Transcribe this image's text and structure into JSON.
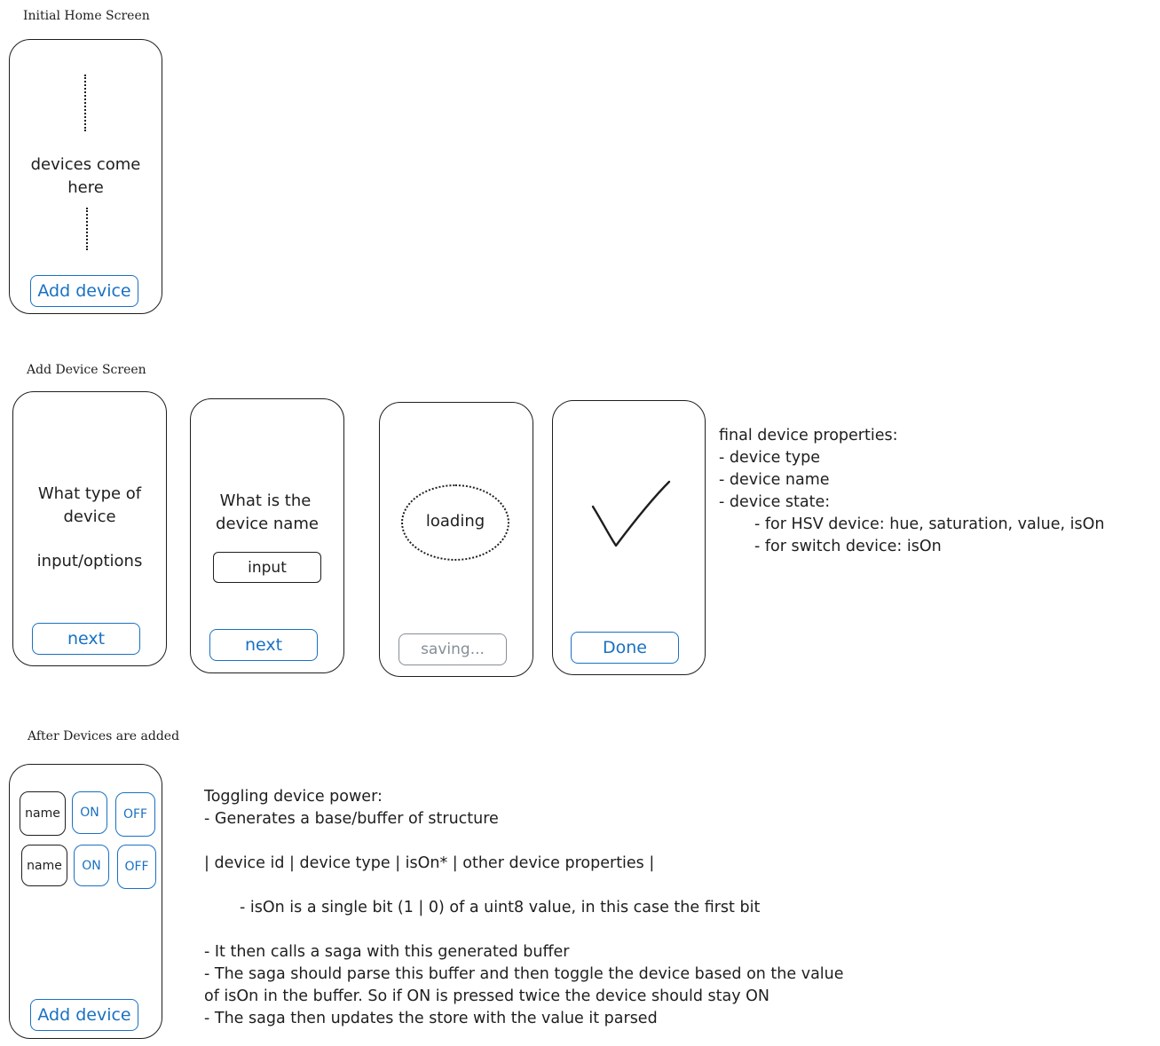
{
  "home": {
    "title": "Initial Home Screen",
    "placeholder_line1": "devices come",
    "placeholder_line2": "here",
    "add_button": "Add device"
  },
  "add_device": {
    "title": "Add Device Screen",
    "step1": {
      "line1": "What type of",
      "line2": "device",
      "line3": "input/options",
      "button": "next"
    },
    "step2": {
      "line1": "What is the",
      "line2": "device name",
      "input_label": "input",
      "button": "next"
    },
    "step3": {
      "loading": "loading",
      "button": "saving..."
    },
    "step4": {
      "button": "Done"
    },
    "properties_notes": [
      "final device properties:",
      "- device type",
      "- device name",
      "- device state:",
      "      - for HSV device: hue, saturation, value, isOn",
      "      - for switch device: isOn"
    ]
  },
  "after": {
    "title": "After Devices are added",
    "rows": [
      {
        "name": "name",
        "on": "ON",
        "off": "OFF"
      },
      {
        "name": "name",
        "on": "ON",
        "off": "OFF"
      }
    ],
    "add_button": "Add device",
    "notes": [
      "Toggling device power:",
      "- Generates a base/buffer of structure",
      "",
      "| device id | device type | isOn* | other device properties |",
      "",
      "     - isOn is a single bit (1 | 0) of a uint8 value, in this case the first bit",
      "",
      "- It then calls a saga with this generated buffer",
      "- The saga should parse this buffer and then toggle the device based on the value",
      "of isOn in the buffer. So if ON is pressed twice the device should stay ON",
      "- The saga then updates the store with the value it parsed"
    ]
  },
  "colors": {
    "stroke": "#1e1e1e",
    "accent_blue": "#1971c2",
    "disabled_grey": "#868e96"
  }
}
